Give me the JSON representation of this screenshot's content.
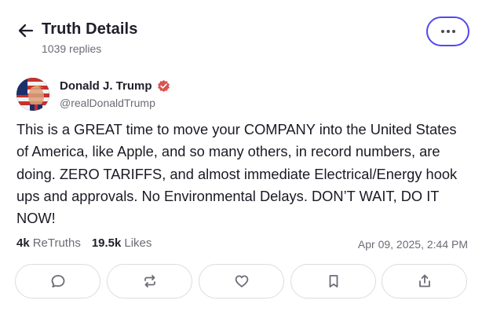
{
  "header": {
    "back_icon": "arrow-left-icon",
    "title": "Truth Details",
    "replies": "1039 replies",
    "more_icon": "more-horizontal-icon",
    "accent_color": "#5448ee"
  },
  "author": {
    "name": "Donald J. Trump",
    "handle": "@realDonaldTrump",
    "verified_icon": "verified-badge-icon",
    "verified_color": "#d9534f"
  },
  "post": {
    "text": "This is a GREAT time to move your COMPANY into the United States of America, like Apple, and so many others, in record numbers, are doing. ZERO TARIFFS, and almost immediate Electrical/Energy hook ups and approvals. No Environmental Delays. DON’T WAIT, DO IT NOW!"
  },
  "stats": {
    "retruths_count": "4k",
    "retruths_label": "ReTruths",
    "likes_count": "19.5k",
    "likes_label": "Likes",
    "timestamp": "Apr 09, 2025, 2:44 PM"
  },
  "actions": [
    {
      "icon": "reply-icon"
    },
    {
      "icon": "retruth-icon"
    },
    {
      "icon": "like-heart-icon"
    },
    {
      "icon": "bookmark-icon"
    },
    {
      "icon": "share-icon"
    }
  ]
}
